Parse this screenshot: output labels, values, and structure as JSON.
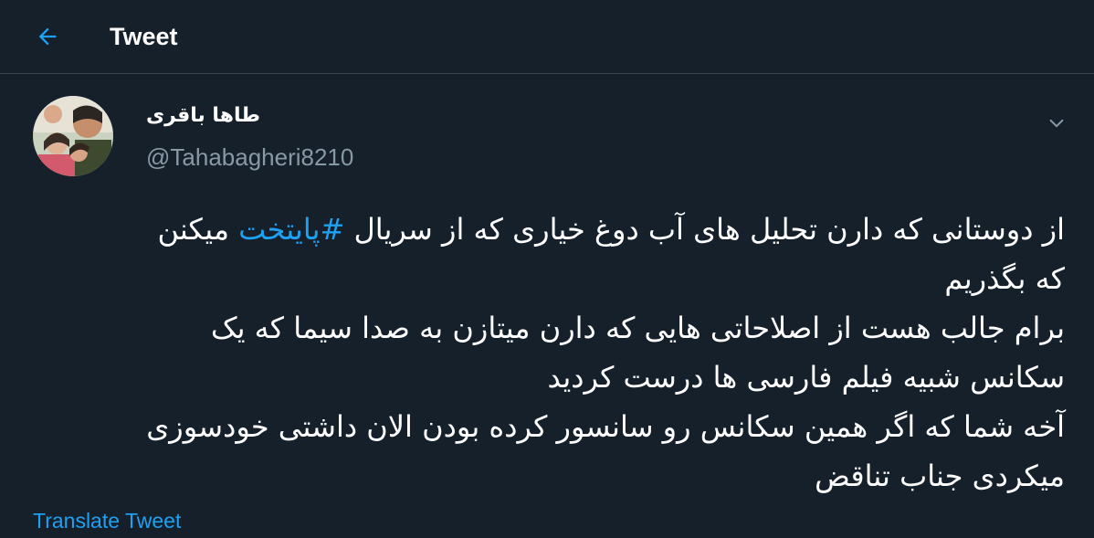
{
  "header": {
    "title": "Tweet",
    "back_icon": "arrow-left-icon"
  },
  "user": {
    "display_name": "طاها باقری",
    "handle": "@Tahabagheri8210"
  },
  "tweet": {
    "line1_prefix": "از دوستانی که دارن تحلیل های آب دوغ خیاری که از سریال ",
    "hashtag": "#پایتخت",
    "line1_suffix": " میکنن",
    "line2": "که بگذریم",
    "line3": "برام جالب هست از اصلاحاتی هایی که دارن میتازن به صدا سیما که یک",
    "line4": "سکانس شبیه فیلم فارسی ها درست کردید",
    "line5": "آخه شما که اگر همین سکانس رو سانسور کرده بودن الان داشتی خودسوزی",
    "line6": "میکردی جناب تناقض"
  },
  "translate_label": "Translate Tweet",
  "colors": {
    "background": "#15202b",
    "accent": "#1da1f2",
    "secondary_text": "#8899a6",
    "divider": "#38444d"
  }
}
